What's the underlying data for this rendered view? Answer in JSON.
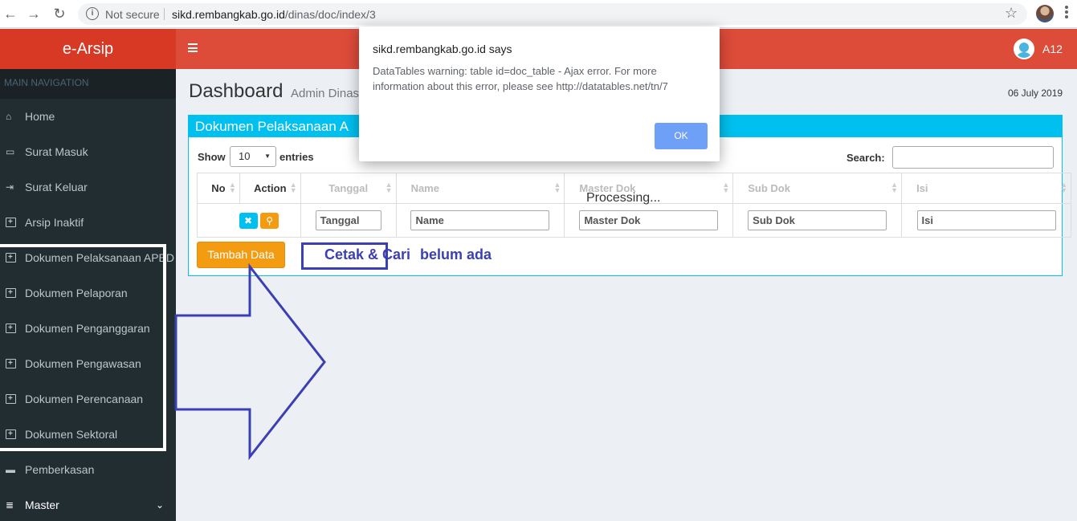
{
  "browser": {
    "security": "Not secure",
    "url_host": "sikd.rembangkab.go.id",
    "url_path": "/dinas/doc/index/3"
  },
  "header": {
    "logo": "e-Arsip",
    "user": "A12"
  },
  "sidebar": {
    "header": "MAIN NAVIGATION",
    "items": [
      {
        "label": "Home",
        "icon": "home-icon"
      },
      {
        "label": "Surat Masuk",
        "icon": "inbox-icon"
      },
      {
        "label": "Surat Keluar",
        "icon": "sign-out-icon"
      },
      {
        "label": "Arsip Inaktif",
        "icon": "calendar-icon"
      },
      {
        "label": "Dokumen Pelaksanaan APBD",
        "icon": "calendar-plus-icon"
      },
      {
        "label": "Dokumen Pelaporan",
        "icon": "calendar-plus-icon"
      },
      {
        "label": "Dokumen Penganggaran",
        "icon": "calendar-plus-icon"
      },
      {
        "label": "Dokumen Pengawasan",
        "icon": "calendar-plus-icon"
      },
      {
        "label": "Dokumen Perencanaan",
        "icon": "calendar-plus-icon"
      },
      {
        "label": "Dokumen Sektoral",
        "icon": "calendar-plus-icon"
      },
      {
        "label": "Pemberkasan",
        "icon": "archive-icon"
      },
      {
        "label": "Master",
        "icon": "database-icon"
      }
    ]
  },
  "content": {
    "title": "Dashboard",
    "subtitle": "Admin Dinas",
    "date": "06 July 2019",
    "box_title": "Dokumen Pelaksanaan A",
    "show_label": "Show",
    "entries_value": "10",
    "entries_label": "entries",
    "search_label": "Search:",
    "processing": "Processing...",
    "add_button": "Tambah Data",
    "columns": [
      "No",
      "Action",
      "Tanggal",
      "Name",
      "Master Dok",
      "Sub Dok",
      "Isi"
    ],
    "filters": {
      "tanggal": "Tanggal",
      "name": "Name",
      "master_dok": "Master Dok",
      "sub_dok": "Sub Dok",
      "isi": "Isi"
    }
  },
  "annotations": {
    "cetak": "Cetak & Cari",
    "belum": "belum ada",
    "color": "#3b3fb5"
  },
  "dialog": {
    "title": "sikd.rembangkab.go.id says",
    "message": "DataTables warning: table id=doc_table - Ajax error. For more information about this error, please see http://datatables.net/tn/7",
    "ok": "OK"
  }
}
